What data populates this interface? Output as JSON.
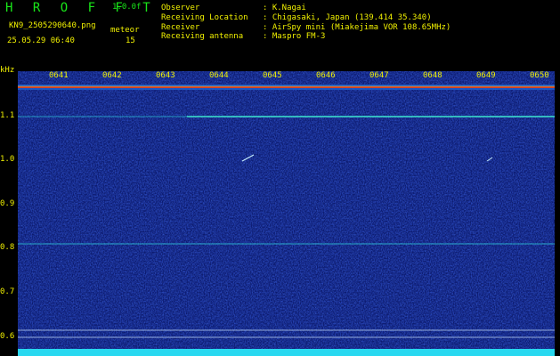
{
  "header": {
    "logo": "H R O F F T",
    "version": "1.0.0f",
    "filename": "KN9_2505290640.png",
    "meteor_label": "meteor",
    "date": "25.05.29 06:40",
    "count": "15",
    "meta": [
      {
        "key": "Observer",
        "value": ": K.Nagai"
      },
      {
        "key": "Receiving Location",
        "value": ": Chigasaki, Japan (139.414 35.340)"
      },
      {
        "key": "Receiver",
        "value": ": AirSpy mini (Miakejima VOR 108.65MHz)"
      },
      {
        "key": "Receiving antenna",
        "value": ": Maspro FM-3"
      }
    ]
  },
  "axis": {
    "unit": "kHz",
    "y_labels": [
      "1.1",
      "1.0",
      "0.9",
      "0.8",
      "0.7",
      "0.6"
    ],
    "time_labels": [
      "0641",
      "0642",
      "0643",
      "0644",
      "0645",
      "0646",
      "0647",
      "0648",
      "0649",
      "0650"
    ]
  },
  "colors": {
    "text": "#f0f000",
    "logo": "#19e619",
    "background": "#0c1a6e"
  }
}
